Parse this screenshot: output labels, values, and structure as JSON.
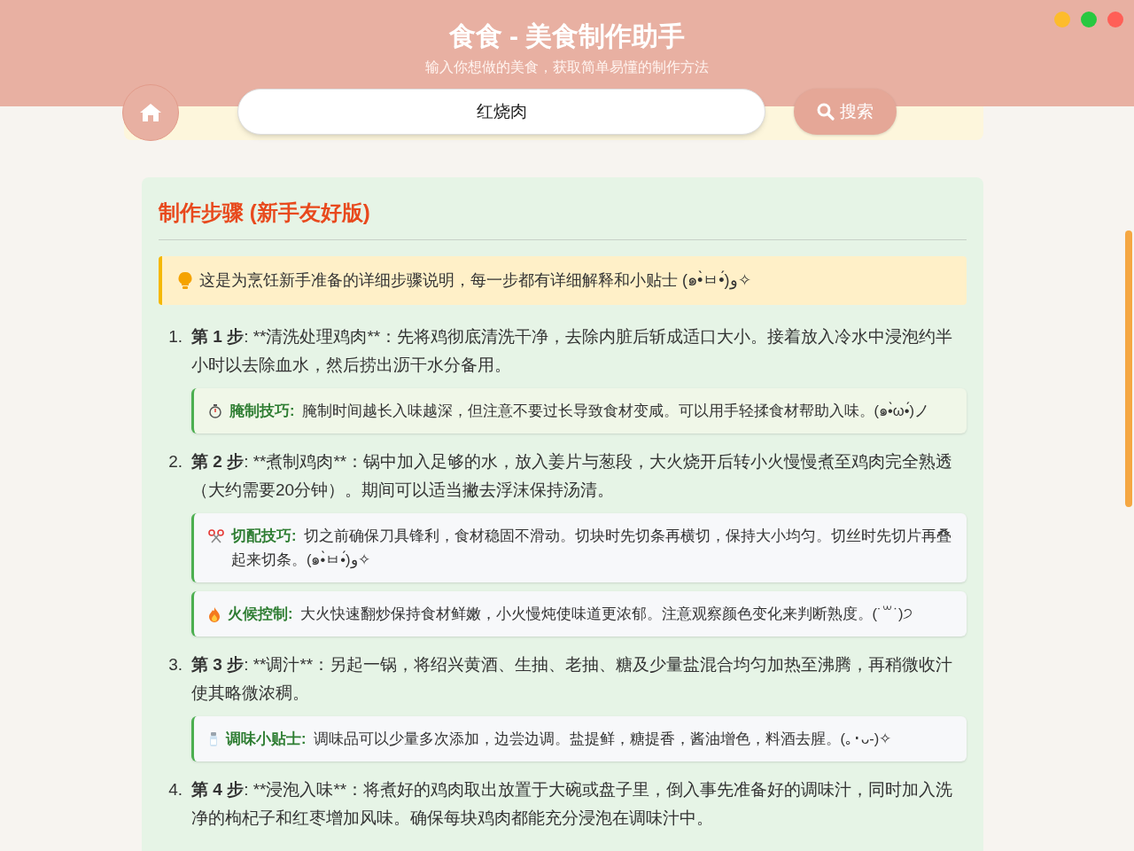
{
  "header": {
    "title": "食食 - 美食制作助手",
    "subtitle": "输入你想做的美食，获取简单易懂的制作方法"
  },
  "window_controls": [
    {
      "color": "#fdbc2c"
    },
    {
      "color": "#28c840"
    },
    {
      "color": "#ff5f57"
    }
  ],
  "search": {
    "value": "红烧肉",
    "button": "搜索"
  },
  "steps_card": {
    "title": "制作步骤 (新手友好版)",
    "notice": "这是为烹饪新手准备的详细步骤说明，每一步都有详细解释和小贴士 (๑•̀ㅂ•́)و✧",
    "steps": [
      {
        "number": "1.",
        "label": "第 1 步",
        "text": ": **清洗处理鸡肉**：先将鸡彻底清洗干净，去除内脏后斩成适口大小。接着放入冷水中浸泡约半小时以去除血水，然后捞出沥干水分备用。",
        "tips": [
          {
            "kind": "timer",
            "highlighted": true,
            "title": "腌制技巧:",
            "text": "腌制时间越长入味越深，但注意不要过长导致食材变咸。可以用手轻揉食材帮助入味。(๑•̀ω•́)ノ"
          }
        ]
      },
      {
        "number": "2.",
        "label": "第 2 步",
        "text": ": **煮制鸡肉**：锅中加入足够的水，放入姜片与葱段，大火烧开后转小火慢慢煮至鸡肉完全熟透（大约需要20分钟）。期间可以适当撇去浮沫保持汤清。",
        "tips": [
          {
            "kind": "scissors",
            "highlighted": false,
            "title": "切配技巧:",
            "text": "切之前确保刀具锋利，食材稳固不滑动。切块时先切条再横切，保持大小均匀。切丝时先切片再叠起来切条。(๑•̀ㅂ•́)و✧"
          },
          {
            "kind": "fire",
            "highlighted": false,
            "title": "火候控制:",
            "text": "大火快速翻炒保持食材鲜嫩，小火慢炖使味道更浓郁。注意观察颜色变化来判断熟度。(˙꒳˙)੭"
          }
        ]
      },
      {
        "number": "3.",
        "label": "第 3 步",
        "text": ": **调汁**：另起一锅，将绍兴黄酒、生抽、老抽、糖及少量盐混合均匀加热至沸腾，再稍微收汁使其略微浓稠。",
        "tips": [
          {
            "kind": "salt",
            "highlighted": false,
            "title": "调味小贴士:",
            "text": "调味品可以少量多次添加，边尝边调。盐提鲜，糖提香，酱油增色，料酒去腥。(｡･ᴗ-)✧"
          }
        ]
      },
      {
        "number": "4.",
        "label": "第 4 步",
        "text": ": **浸泡入味**：将煮好的鸡肉取出放置于大碗或盘子里，倒入事先准备好的调味汁，同时加入洗净的枸杞子和红枣增加风味。确保每块鸡肉都能充分浸泡在调味汁中。"
      }
    ]
  }
}
